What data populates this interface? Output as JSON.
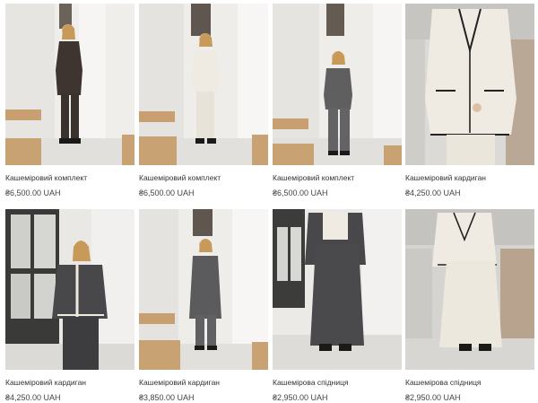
{
  "products": [
    {
      "name": "Кашеміровий комплект",
      "price": "₴6,500.00 UAH",
      "image": "dark-brown-cashmere-set"
    },
    {
      "name": "Кашеміровий комплект",
      "price": "₴6,500.00 UAH",
      "image": "cream-cashmere-set"
    },
    {
      "name": "Кашеміровий комплект",
      "price": "₴6,500.00 UAH",
      "image": "grey-cashmere-set"
    },
    {
      "name": "Кашеміровий кардиган",
      "price": "₴4,250.00 UAH",
      "image": "cream-cardigan-black-trim"
    },
    {
      "name": "Кашеміровий кардиган",
      "price": "₴4,250.00 UAH",
      "image": "charcoal-cardigan-cream-trim"
    },
    {
      "name": "Кашеміровий кардиган",
      "price": "₴3,850.00 UAH",
      "image": "grey-long-cardigan"
    },
    {
      "name": "Кашемірова спідниця",
      "price": "₴2,950.00 UAH",
      "image": "charcoal-maxi-skirt"
    },
    {
      "name": "Кашемірова спідниця",
      "price": "₴2,950.00 UAH",
      "image": "cream-maxi-skirt"
    }
  ],
  "colors": {
    "wall": "#ecebe8",
    "floor": "#e4e2de",
    "wood": "#c9a274",
    "dark_brown": "#3e3530",
    "cream": "#eeeae2",
    "grey": "#5f5f60",
    "charcoal": "#48474a",
    "text": "#333333"
  }
}
